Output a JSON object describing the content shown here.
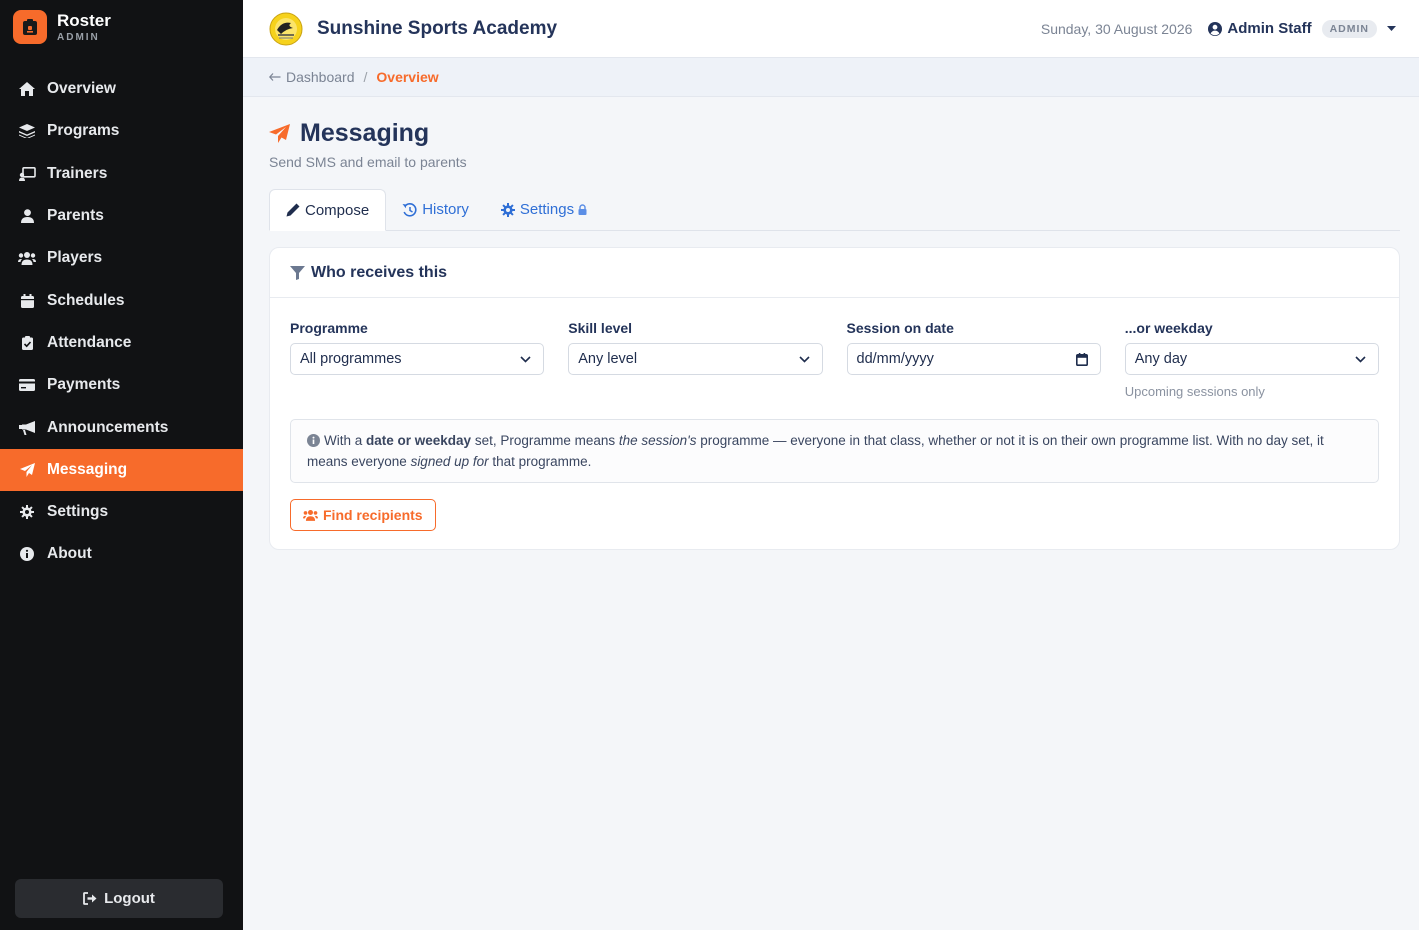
{
  "app": {
    "name": "Roster",
    "sub": "ADMIN"
  },
  "sidebar": {
    "items": [
      {
        "label": "Overview",
        "icon": "home-icon"
      },
      {
        "label": "Programs",
        "icon": "layers-icon"
      },
      {
        "label": "Trainers",
        "icon": "chalkboard-teacher-icon"
      },
      {
        "label": "Parents",
        "icon": "user-icon"
      },
      {
        "label": "Players",
        "icon": "users-icon"
      },
      {
        "label": "Schedules",
        "icon": "calendar-icon"
      },
      {
        "label": "Attendance",
        "icon": "clipboard-check-icon"
      },
      {
        "label": "Payments",
        "icon": "credit-card-icon"
      },
      {
        "label": "Announcements",
        "icon": "megaphone-icon"
      },
      {
        "label": "Messaging",
        "icon": "paper-plane-icon",
        "active": true
      },
      {
        "label": "Settings",
        "icon": "gear-icon"
      },
      {
        "label": "About",
        "icon": "info-circle-icon"
      }
    ],
    "logout": "Logout"
  },
  "topbar": {
    "academy": "Sunshine Sports Academy",
    "date": "Sunday, 30 August 2026",
    "user": "Admin Staff",
    "role": "ADMIN"
  },
  "breadcrumb": {
    "back": "Dashboard",
    "sep": "/",
    "current": "Overview"
  },
  "page": {
    "title": "Messaging",
    "subtitle": "Send SMS and email to parents"
  },
  "tabs": {
    "compose": "Compose",
    "history": "History",
    "settings": "Settings"
  },
  "filters": {
    "heading": "Who receives this",
    "programme": {
      "label": "Programme",
      "value": "All programmes"
    },
    "skill": {
      "label": "Skill level",
      "value": "Any level"
    },
    "date": {
      "label": "Session on date",
      "placeholder": "dd/mm/yyyy"
    },
    "weekday": {
      "label": "...or weekday",
      "value": "Any day",
      "hint": "Upcoming sessions only"
    },
    "info": {
      "t1": "With a ",
      "b1": "date or weekday",
      "t2": " set, Programme means ",
      "i1": "the session's",
      "t3": " programme — everyone in that class, whether or not it is on their own programme list. With no day set, it means everyone ",
      "i2": "signed up for",
      "t4": " that programme."
    },
    "find_button": "Find recipients"
  },
  "colors": {
    "accent": "#f76b2b",
    "sidebar_bg": "#111214",
    "link": "#2f6fd6",
    "title": "#24345a"
  }
}
